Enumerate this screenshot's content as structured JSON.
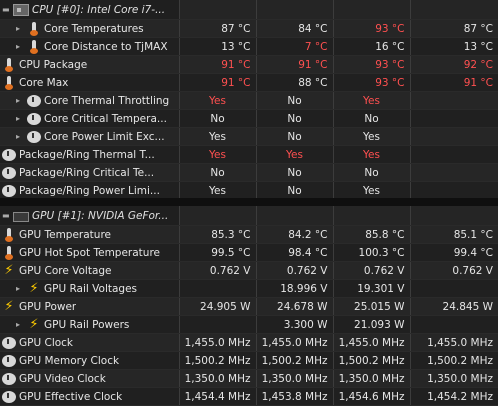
{
  "cpu": {
    "header": "CPU [#0]: Intel Core i7-...",
    "rows": [
      {
        "label": "Core Temperatures",
        "icon": "thermometer-icon",
        "indent": 1,
        "values": [
          "87 °C",
          "84 °C",
          "93 °C",
          "87 °C"
        ],
        "red": [
          false,
          false,
          true,
          false
        ]
      },
      {
        "label": "Core Distance to TjMAX",
        "icon": "thermometer-icon",
        "indent": 1,
        "values": [
          "13 °C",
          "7 °C",
          "16 °C",
          "13 °C"
        ],
        "red": [
          false,
          true,
          false,
          false
        ]
      },
      {
        "label": "CPU Package",
        "icon": "thermometer-icon",
        "indent": 0,
        "values": [
          "91 °C",
          "91 °C",
          "93 °C",
          "92 °C"
        ],
        "red": [
          true,
          true,
          true,
          true
        ]
      },
      {
        "label": "Core Max",
        "icon": "thermometer-icon",
        "indent": 0,
        "values": [
          "91 °C",
          "88 °C",
          "93 °C",
          "91 °C"
        ],
        "red": [
          true,
          false,
          true,
          true
        ]
      },
      {
        "label": "Core Thermal Throttling",
        "icon": "clock-icon",
        "indent": 1,
        "values": [
          "Yes",
          "No",
          "Yes",
          ""
        ],
        "red": [
          true,
          false,
          true,
          false
        ]
      },
      {
        "label": "Core Critical Tempera...",
        "icon": "clock-icon",
        "indent": 1,
        "values": [
          "No",
          "No",
          "No",
          ""
        ],
        "red": [
          false,
          false,
          false,
          false
        ]
      },
      {
        "label": "Core Power Limit Exc...",
        "icon": "clock-icon",
        "indent": 1,
        "values": [
          "Yes",
          "No",
          "Yes",
          ""
        ],
        "red": [
          false,
          false,
          false,
          false
        ]
      },
      {
        "label": "Package/Ring Thermal T...",
        "icon": "clock-icon",
        "indent": 0,
        "values": [
          "Yes",
          "Yes",
          "Yes",
          ""
        ],
        "red": [
          true,
          true,
          true,
          false
        ]
      },
      {
        "label": "Package/Ring Critical Te...",
        "icon": "clock-icon",
        "indent": 0,
        "values": [
          "No",
          "No",
          "No",
          ""
        ],
        "red": [
          false,
          false,
          false,
          false
        ]
      },
      {
        "label": "Package/Ring Power Limi...",
        "icon": "clock-icon",
        "indent": 0,
        "values": [
          "Yes",
          "No",
          "Yes",
          ""
        ],
        "red": [
          false,
          false,
          false,
          false
        ]
      }
    ]
  },
  "gpu": {
    "header": "GPU [#1]: NVIDIA GeFor...",
    "rows": [
      {
        "label": "GPU Temperature",
        "icon": "thermometer-icon",
        "indent": 0,
        "values": [
          "85.3 °C",
          "84.2 °C",
          "85.8 °C",
          "85.1 °C"
        ],
        "red": [
          false,
          false,
          false,
          false
        ]
      },
      {
        "label": "GPU Hot Spot Temperature",
        "icon": "thermometer-icon",
        "indent": 0,
        "values": [
          "99.5 °C",
          "98.4 °C",
          "100.3 °C",
          "99.4 °C"
        ],
        "red": [
          false,
          false,
          false,
          false
        ]
      },
      {
        "label": "GPU Core Voltage",
        "icon": "lightning-icon",
        "indent": 0,
        "values": [
          "0.762 V",
          "0.762 V",
          "0.762 V",
          "0.762 V"
        ],
        "red": [
          false,
          false,
          false,
          false
        ]
      },
      {
        "label": "GPU Rail Voltages",
        "icon": "lightning-icon",
        "indent": 1,
        "values": [
          "",
          "18.996 V",
          "19.301 V",
          ""
        ],
        "red": [
          false,
          false,
          false,
          false
        ]
      },
      {
        "label": "GPU Power",
        "icon": "lightning-icon",
        "indent": 0,
        "values": [
          "24.905 W",
          "24.678 W",
          "25.015 W",
          "24.845 W"
        ],
        "red": [
          false,
          false,
          false,
          false
        ]
      },
      {
        "label": "GPU Rail Powers",
        "icon": "lightning-icon",
        "indent": 1,
        "values": [
          "",
          "3.300 W",
          "21.093 W",
          ""
        ],
        "red": [
          false,
          false,
          false,
          false
        ]
      },
      {
        "label": "GPU Clock",
        "icon": "clock-icon",
        "indent": 0,
        "values": [
          "1,455.0 MHz",
          "1,455.0 MHz",
          "1,455.0 MHz",
          "1,455.0 MHz"
        ],
        "red": [
          false,
          false,
          false,
          false
        ]
      },
      {
        "label": "GPU Memory Clock",
        "icon": "clock-icon",
        "indent": 0,
        "values": [
          "1,500.2 MHz",
          "1,500.2 MHz",
          "1,500.2 MHz",
          "1,500.2 MHz"
        ],
        "red": [
          false,
          false,
          false,
          false
        ]
      },
      {
        "label": "GPU Video Clock",
        "icon": "clock-icon",
        "indent": 0,
        "values": [
          "1,350.0 MHz",
          "1,350.0 MHz",
          "1,350.0 MHz",
          "1,350.0 MHz"
        ],
        "red": [
          false,
          false,
          false,
          false
        ]
      },
      {
        "label": "GPU Effective Clock",
        "icon": "clock-icon",
        "indent": 0,
        "values": [
          "1,454.4 MHz",
          "1,453.8 MHz",
          "1,454.6 MHz",
          "1,454.2 MHz"
        ],
        "red": [
          false,
          false,
          false,
          false
        ]
      }
    ]
  },
  "colors": {
    "alert": "#ff5050",
    "text": "#e6e6e6",
    "background": "#1c1c1c"
  }
}
